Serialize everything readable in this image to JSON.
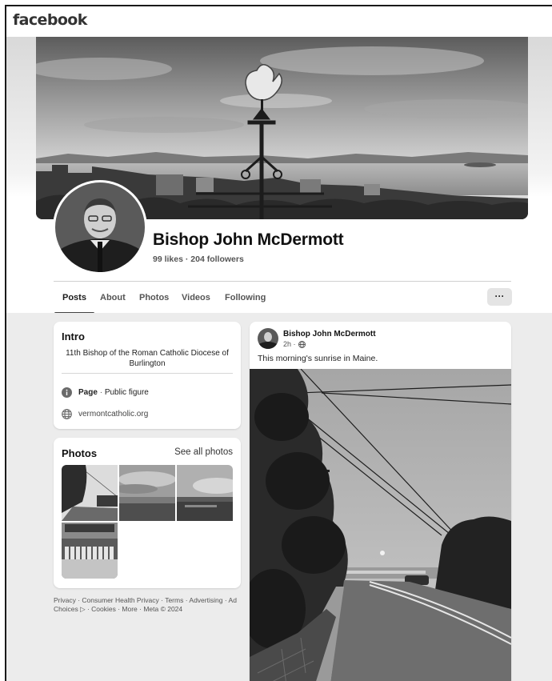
{
  "app": {
    "logo": "facebook"
  },
  "profile": {
    "name": "Bishop John McDermott",
    "stats": "99 likes · 204 followers"
  },
  "tabs": [
    {
      "label": "Posts",
      "active": true
    },
    {
      "label": "About",
      "active": false
    },
    {
      "label": "Photos",
      "active": false
    },
    {
      "label": "Videos",
      "active": false
    },
    {
      "label": "Following",
      "active": false
    }
  ],
  "more_button": {
    "label": "···"
  },
  "intro": {
    "title": "Intro",
    "bio": "11th Bishop of the Roman Catholic Diocese of Burlington",
    "page_label": "Page",
    "page_separator": "·",
    "page_category": "Public figure",
    "website": "vermontcatholic.org",
    "icons": {
      "info": "info-icon",
      "web": "globe-icon"
    }
  },
  "photos": {
    "title": "Photos",
    "see_all": "See all photos"
  },
  "footer": {
    "text": "Privacy · Consumer Health Privacy · Terms · Advertising · Ad Choices ▷ · Cookies · More · Meta © 2024"
  },
  "post": {
    "author": "Bishop John McDermott",
    "time": "2h ·",
    "audience_icon": "globe-icon",
    "text": "This morning's sunrise in Maine."
  },
  "colors": {
    "feed_background": "#ececec",
    "card_background": "#ffffff",
    "text_primary": "#111111",
    "text_secondary": "#555555"
  }
}
